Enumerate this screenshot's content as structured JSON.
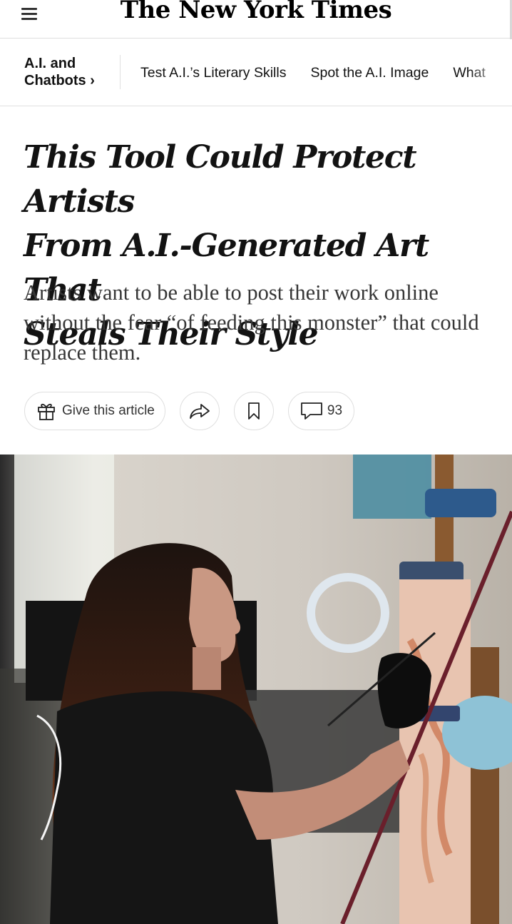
{
  "masthead": {
    "logo_text": "The New York Times"
  },
  "section_nav": {
    "section_line1": "A.I. and",
    "section_line2": "Chatbots ›",
    "links": [
      "Test A.I.’s Literary Skills",
      "Spot the A.I. Image",
      "What"
    ]
  },
  "article": {
    "headline_line1": "This Tool Could Protect Artists",
    "headline_line2": "From A.I.-Generated Art That",
    "headline_line3": "Steals Their Style",
    "summary": "Artists want to be able to post their work online without the fear “of feeding this monster” that could replace them."
  },
  "actions": {
    "gift_label": "Give this article",
    "comment_count": "93"
  },
  "icons": {
    "menu": "hamburger-menu-icon",
    "gift": "gift-icon",
    "share": "share-arrow-icon",
    "save": "bookmark-icon",
    "comments": "comment-bubble-icon"
  }
}
